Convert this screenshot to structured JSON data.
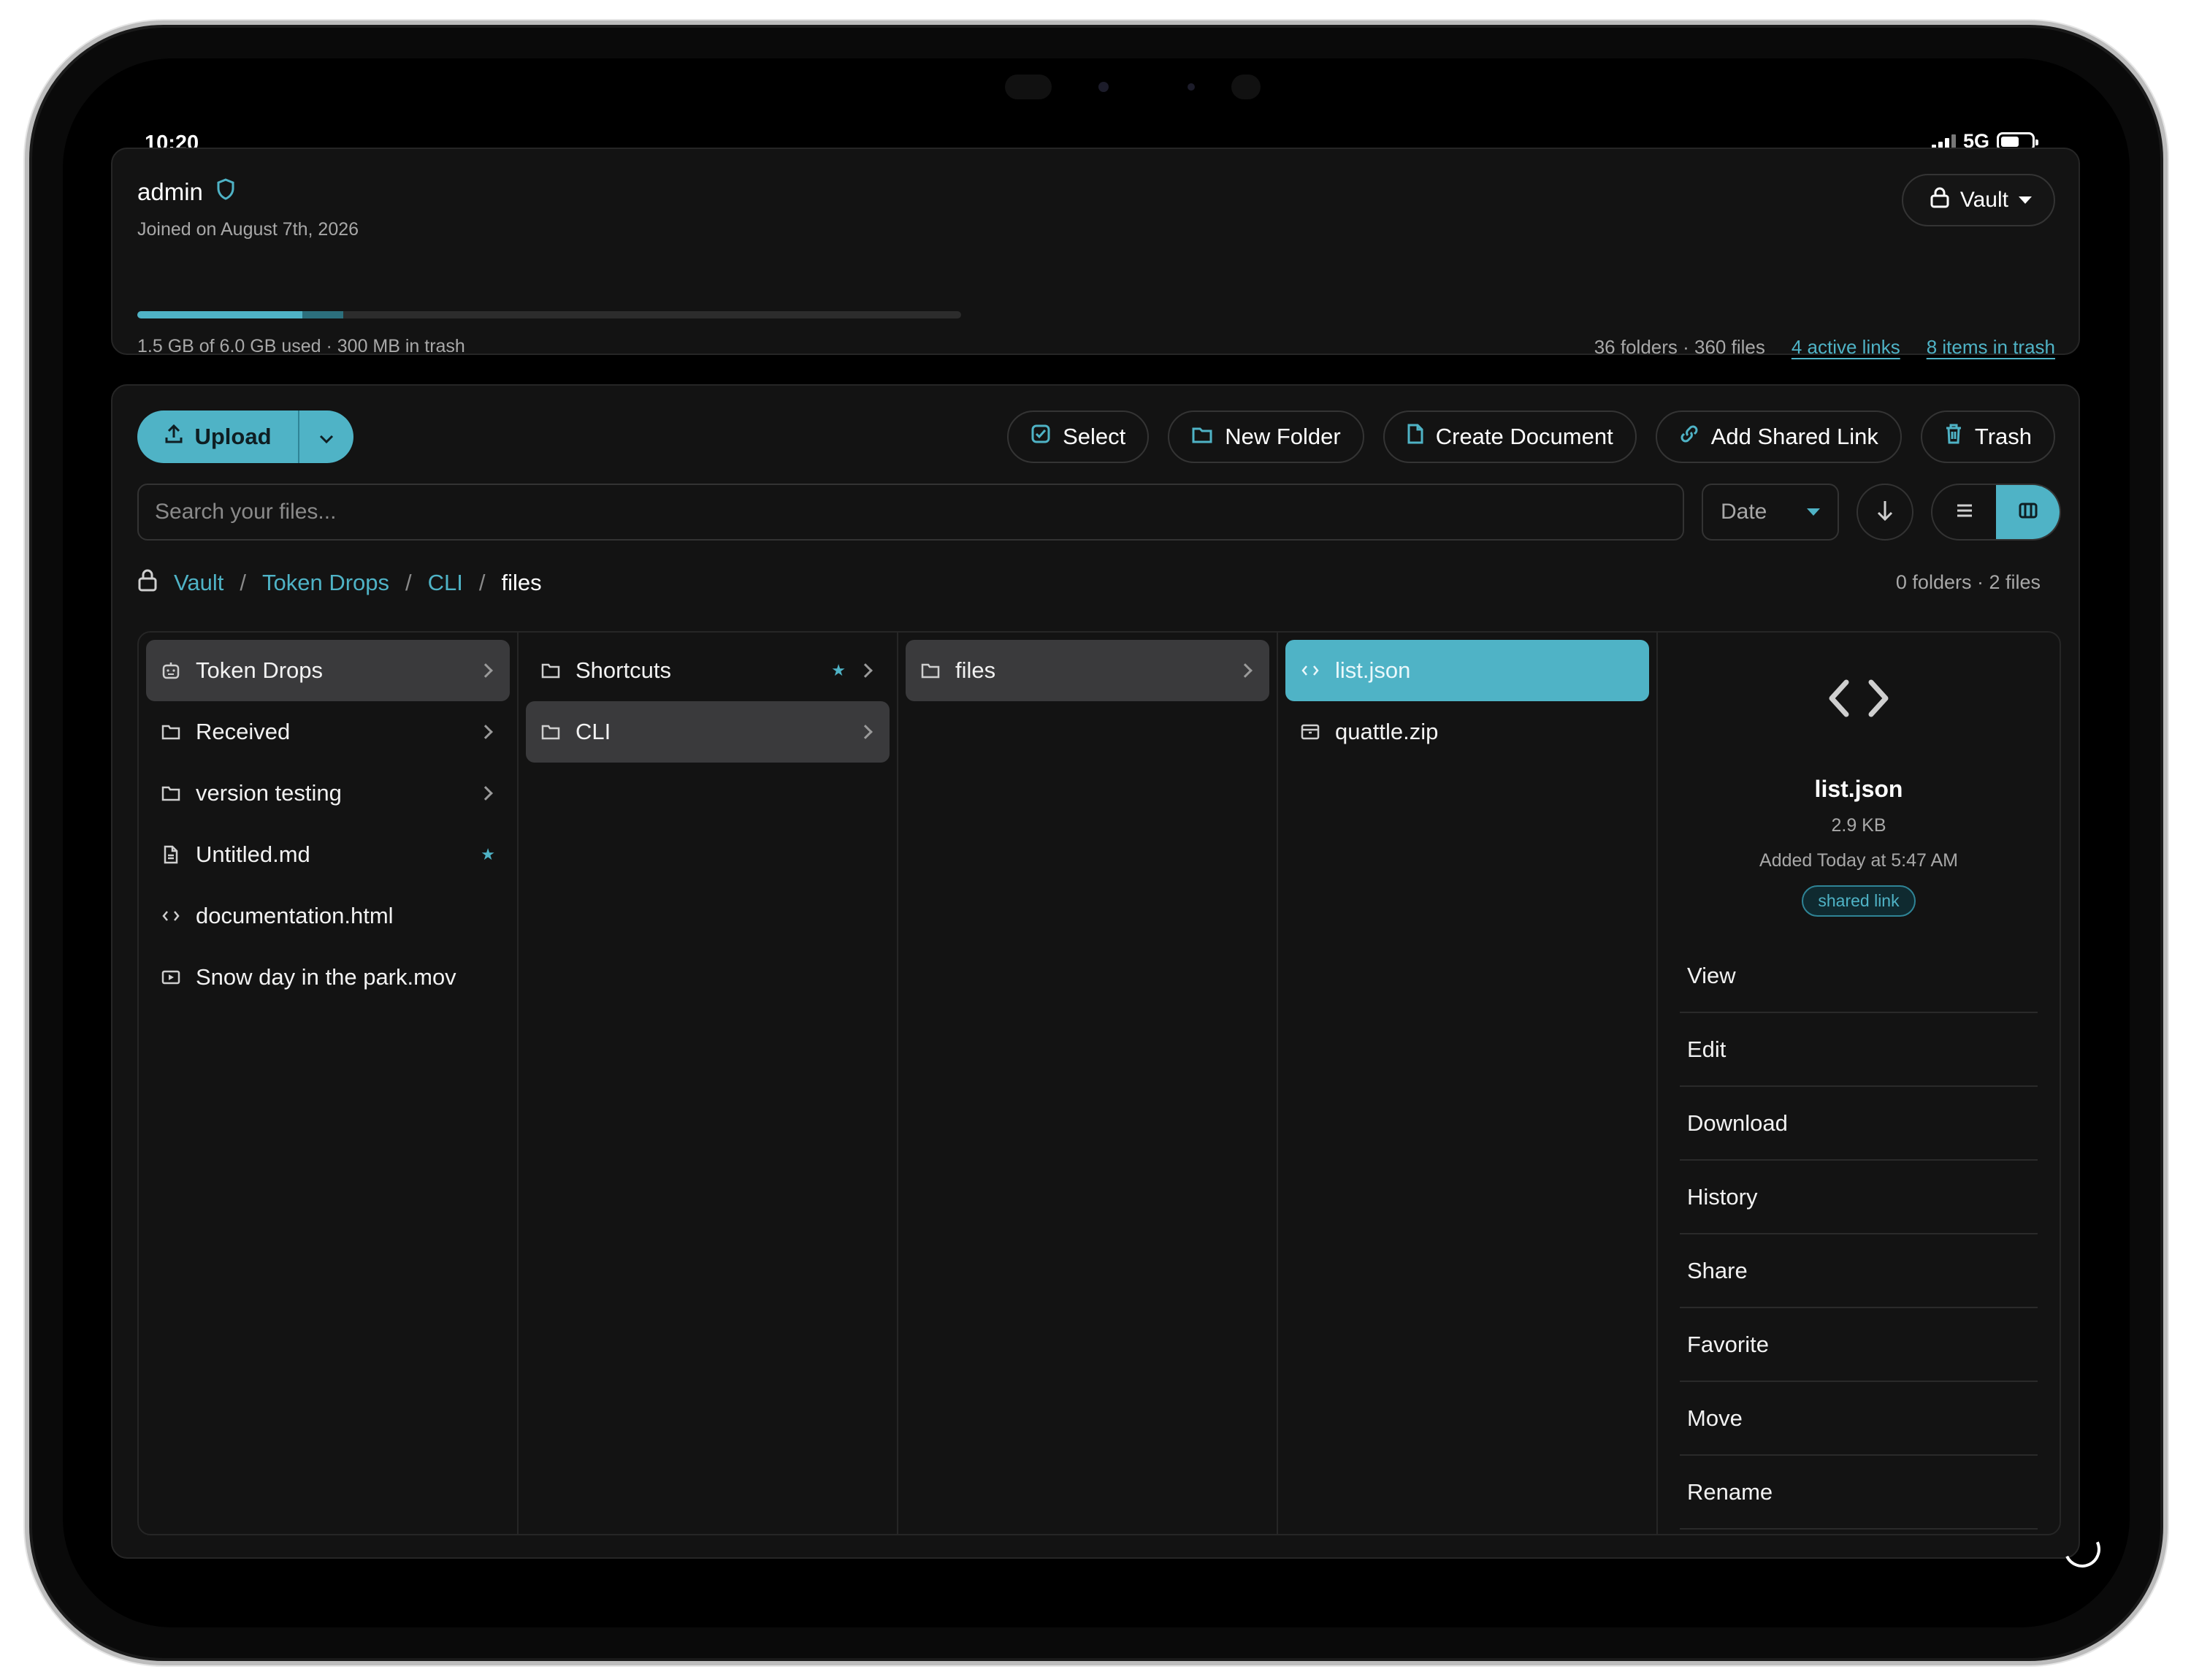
{
  "status": {
    "time": "10:20",
    "network": "5G"
  },
  "account": {
    "name": "admin",
    "joined": "Joined on August 7th, 2026",
    "vault_label": "Vault",
    "storage_text": "1.5 GB of 6.0 GB used · 300 MB in trash",
    "storage_used_fraction": 0.2,
    "storage_trash_fraction": 0.05,
    "counts": "36 folders · 360 files",
    "active_links": "4 active links",
    "trash_items": "8 items in trash"
  },
  "toolbar": {
    "upload": "Upload",
    "select": "Select",
    "new_folder": "New Folder",
    "create_document": "Create Document",
    "add_shared_link": "Add Shared Link",
    "trash": "Trash"
  },
  "search": {
    "placeholder": "Search your files..."
  },
  "sort": {
    "value": "Date"
  },
  "breadcrumb": {
    "items": [
      "Vault",
      "Token Drops",
      "CLI"
    ],
    "current": "files"
  },
  "folder_counts": "0 folders · 2 files",
  "columns": {
    "col1": [
      {
        "label": "Token Drops"
      },
      {
        "label": "Received"
      },
      {
        "label": "version testing"
      },
      {
        "label": "Untitled.md"
      },
      {
        "label": "documentation.html"
      },
      {
        "label": "Snow day in the park.mov"
      }
    ],
    "col2": [
      {
        "label": "Shortcuts"
      },
      {
        "label": "CLI"
      }
    ],
    "col3": [
      {
        "label": "files"
      }
    ],
    "col4": [
      {
        "label": "list.json"
      },
      {
        "label": "quattle.zip"
      }
    ]
  },
  "detail": {
    "name": "list.json",
    "size": "2.9 KB",
    "added": "Added Today at 5:47 AM",
    "badge": "shared link",
    "actions": [
      "View",
      "Edit",
      "Download",
      "History",
      "Share",
      "Favorite",
      "Move",
      "Rename"
    ]
  },
  "colors": {
    "accent": "#4fb3c6",
    "background": "#000000",
    "card": "#131313"
  }
}
